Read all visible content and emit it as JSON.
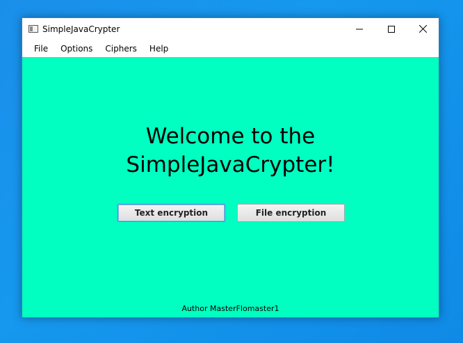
{
  "window": {
    "title": "SimpleJavaCrypter",
    "controls": {
      "minimize": "minimize-icon",
      "maximize": "maximize-icon",
      "close": "close-icon"
    }
  },
  "menubar": {
    "items": [
      "File",
      "Options",
      "Ciphers",
      "Help"
    ]
  },
  "main": {
    "welcome_line1": "Welcome to the",
    "welcome_line2": "SimpleJavaCrypter!",
    "text_encryption_label": "Text encryption",
    "file_encryption_label": "File encryption",
    "author": "Author MasterFlomaster1"
  },
  "colors": {
    "content_background": "#00ffc0",
    "desktop_background": "#1a8fea"
  }
}
